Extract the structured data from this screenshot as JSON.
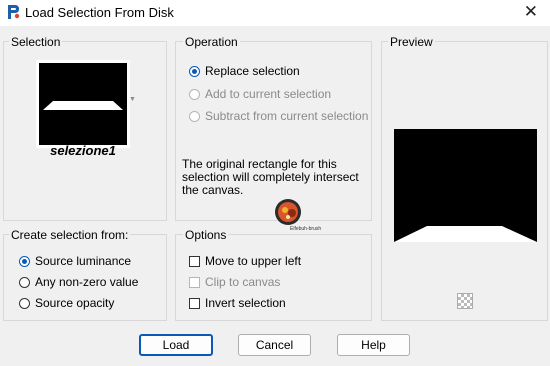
{
  "window": {
    "title": "Load Selection From Disk",
    "close_glyph": "✕"
  },
  "selection": {
    "label": "Selection",
    "name": "selezione1"
  },
  "operation": {
    "label": "Operation",
    "options": [
      {
        "label": "Replace selection",
        "checked": true,
        "enabled": true
      },
      {
        "label": "Add to current selection",
        "checked": false,
        "enabled": false
      },
      {
        "label": "Subtract from current selection",
        "checked": false,
        "enabled": false
      }
    ],
    "info": "The original rectangle for this selection will completely intersect the canvas."
  },
  "preview": {
    "label": "Preview"
  },
  "create_from": {
    "label": "Create selection from:",
    "options": [
      {
        "label": "Source luminance",
        "checked": true
      },
      {
        "label": "Any non-zero value",
        "checked": false
      },
      {
        "label": "Source opacity",
        "checked": false
      }
    ]
  },
  "options": {
    "label": "Options",
    "items": [
      {
        "label": "Move to upper left",
        "checked": false,
        "enabled": true
      },
      {
        "label": "Clip to canvas",
        "checked": false,
        "enabled": false
      },
      {
        "label": "Invert selection",
        "checked": false,
        "enabled": true
      }
    ]
  },
  "watermark": {
    "text": "Elfebuh-brush"
  },
  "buttons": {
    "load": "Load",
    "cancel": "Cancel",
    "help": "Help"
  },
  "colors": {
    "accent": "#0a58b8",
    "selection_shape": "#ffffff",
    "canvas": "#000000"
  }
}
